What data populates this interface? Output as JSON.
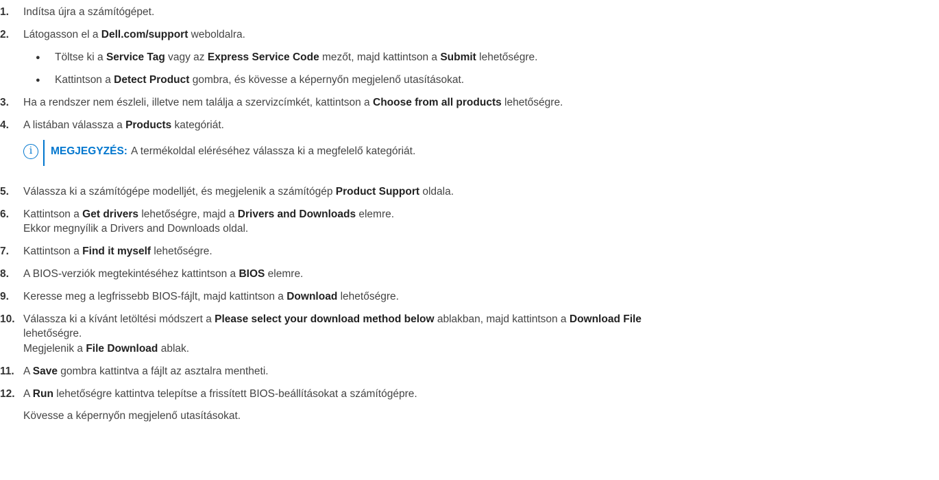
{
  "steps": [
    {
      "num": "1.",
      "parts": [
        "Indítsa újra a számítógépet."
      ]
    },
    {
      "num": "2.",
      "parts": [
        "Látogasson el a ",
        "Dell.com/support",
        " weboldalra."
      ]
    },
    {
      "bullet": "●",
      "parts": [
        "Töltse ki a ",
        "Service Tag",
        " vagy az ",
        "Express Service Code",
        " mezőt, majd kattintson a ",
        "Submit",
        " lehetőségre."
      ]
    },
    {
      "bullet": "●",
      "parts": [
        "Kattintson a ",
        "Detect Product",
        " gombra, és kövesse a képernyőn megjelenő utasításokat."
      ]
    },
    {
      "num": "3.",
      "parts": [
        "Ha a rendszer nem észleli, illetve nem találja a szervizcímkét, kattintson a ",
        "Choose from all products",
        " lehetőségre."
      ]
    },
    {
      "num": "4.",
      "parts": [
        "A listában válassza a ",
        "Products",
        " kategóriát."
      ]
    },
    {
      "num": "5.",
      "parts": [
        "Válassza ki a számítógépe modelljét, és megjelenik a számítógép ",
        "Product Support",
        " oldala."
      ]
    },
    {
      "num": "6.",
      "parts": [
        "Kattintson a ",
        "Get drivers",
        " lehetőségre, majd a ",
        "Drivers and Downloads",
        " elemre."
      ]
    },
    {
      "parts": [
        "Ekkor megnyílik a Drivers and Downloads oldal."
      ]
    },
    {
      "num": "7.",
      "parts": [
        "Kattintson a ",
        "Find it myself",
        " lehetőségre."
      ]
    },
    {
      "num": "8.",
      "parts": [
        "A BIOS-verziók megtekintéséhez kattintson a ",
        "BIOS",
        " elemre."
      ]
    },
    {
      "num": "9.",
      "parts": [
        "Keresse meg a legfrissebb BIOS-fájlt, majd kattintson a ",
        "Download",
        " lehetőségre."
      ]
    },
    {
      "num": "10.",
      "parts": [
        "Válassza ki a kívánt letöltési módszert a ",
        "Please select your download method below",
        " ablakban, majd kattintson a ",
        "Download File"
      ]
    },
    {
      "parts": [
        "lehetőségre."
      ]
    },
    {
      "parts": [
        "Megjelenik a ",
        "File Download",
        " ablak."
      ]
    },
    {
      "num": "11.",
      "parts": [
        "A ",
        "Save",
        " gombra kattintva a fájlt az asztalra mentheti."
      ]
    },
    {
      "num": "12.",
      "parts": [
        "A ",
        "Run",
        " lehetőségre kattintva telepítse a frissített BIOS-beállításokat a számítógépre."
      ]
    },
    {
      "parts": [
        "Kövesse a képernyőn megjelenő utasításokat."
      ]
    }
  ],
  "note": {
    "icon_glyph": "i",
    "label": "MEGJEGYZÉS:",
    "text": "A termékoldal eléréséhez válassza ki a megfelelő kategóriát."
  },
  "colors": {
    "accent": "#0076ce",
    "text": "#444444"
  }
}
